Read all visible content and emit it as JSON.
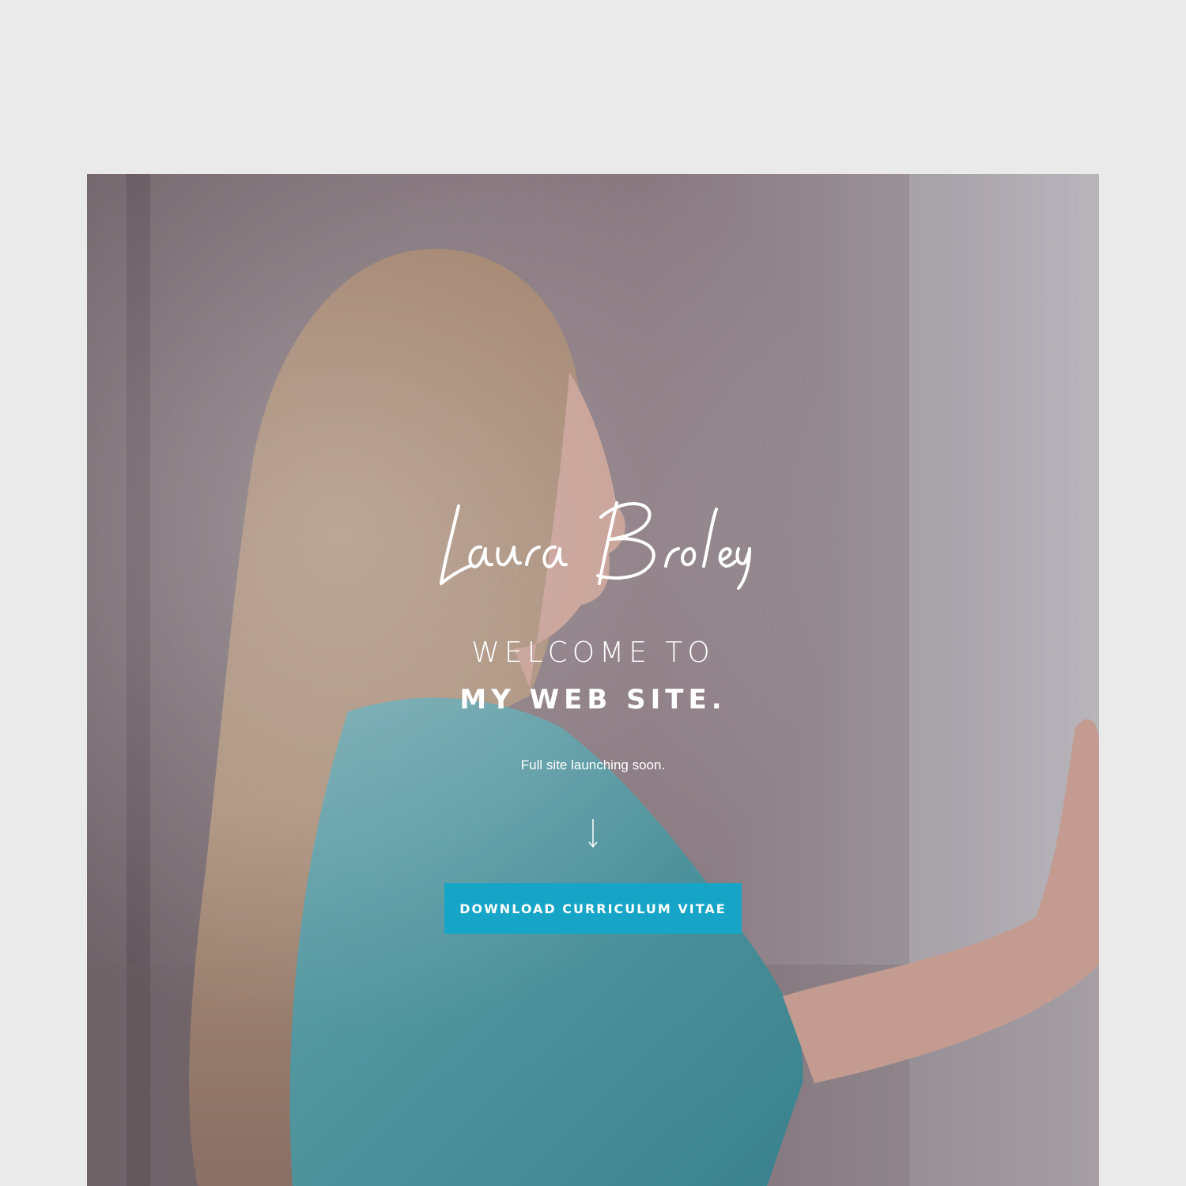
{
  "hero": {
    "signature_text": "Laura Broley",
    "welcome_line": "WELCOME TO",
    "title_line": "MY WEB SITE.",
    "subtitle": "Full site launching soon.",
    "cta_label": "DOWNLOAD CURRICULUM VITAE",
    "scroll_icon": "arrow-down-icon"
  },
  "colors": {
    "page_background": "#eaeaea",
    "cta_background": "#17a5c7",
    "text": "#ffffff"
  }
}
